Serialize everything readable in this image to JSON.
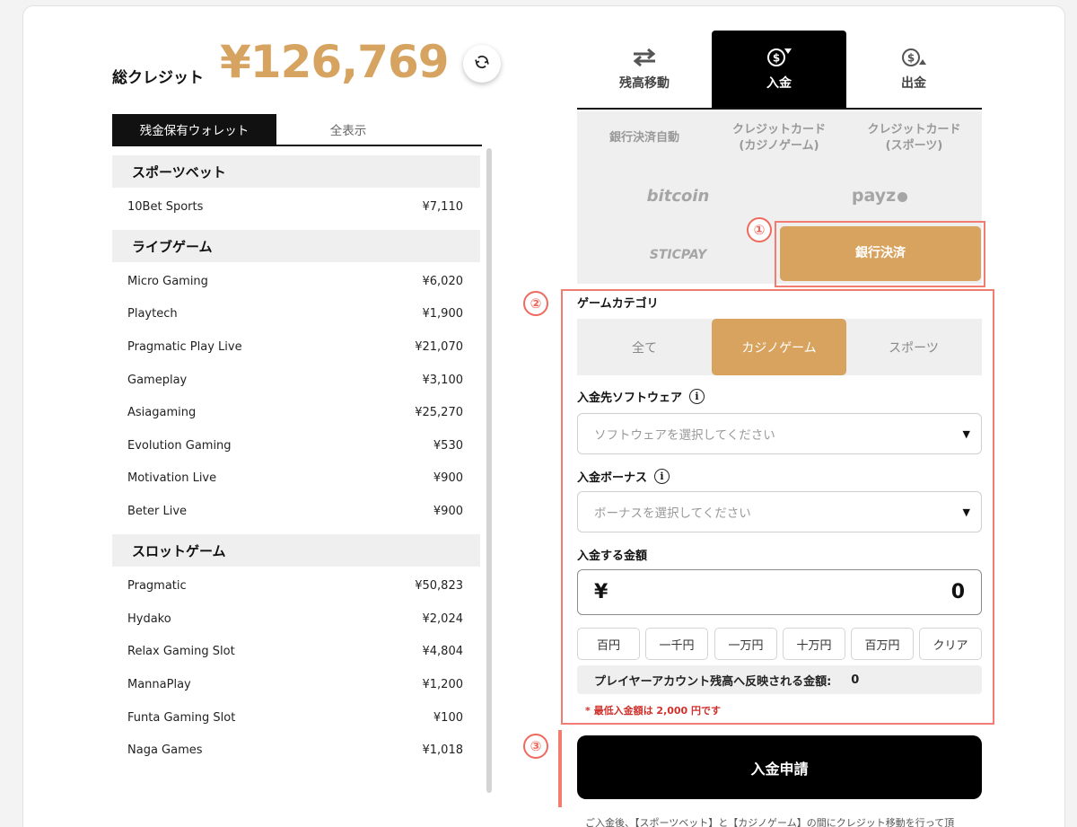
{
  "credit": {
    "label": "総クレジット",
    "amount": "¥126,769"
  },
  "wallet_tabs": {
    "active": "残金保有ウォレット",
    "inactive": "全表示"
  },
  "wallet": {
    "categories": [
      {
        "name": "スポーツベット",
        "rows": [
          {
            "name": "10Bet Sports",
            "value": "¥7,110"
          }
        ]
      },
      {
        "name": "ライブゲーム",
        "rows": [
          {
            "name": "Micro Gaming",
            "value": "¥6,020"
          },
          {
            "name": "Playtech",
            "value": "¥1,900"
          },
          {
            "name": "Pragmatic Play Live",
            "value": "¥21,070"
          },
          {
            "name": "Gameplay",
            "value": "¥3,100"
          },
          {
            "name": "Asiagaming",
            "value": "¥25,270"
          },
          {
            "name": "Evolution Gaming",
            "value": "¥530"
          },
          {
            "name": "Motivation Live",
            "value": "¥900"
          },
          {
            "name": "Beter Live",
            "value": "¥900"
          }
        ]
      },
      {
        "name": "スロットゲーム",
        "rows": [
          {
            "name": "Pragmatic",
            "value": "¥50,823"
          },
          {
            "name": "Hydako",
            "value": "¥2,024"
          },
          {
            "name": "Relax Gaming Slot",
            "value": "¥4,804"
          },
          {
            "name": "MannaPlay",
            "value": "¥1,200"
          },
          {
            "name": "Funta Gaming Slot",
            "value": "¥100"
          },
          {
            "name": "Naga Games",
            "value": "¥1,018"
          }
        ]
      }
    ]
  },
  "top_tabs": [
    {
      "label": "残高移動",
      "icon": "transfer-arrows-icon"
    },
    {
      "label": "入金",
      "icon": "dollar-down-icon",
      "active": true
    },
    {
      "label": "出金",
      "icon": "dollar-up-icon"
    }
  ],
  "methods": {
    "bank_auto": "銀行決済自動",
    "credit_casino_1": "クレジットカード",
    "credit_casino_2": "(カジノゲーム)",
    "credit_sports_1": "クレジットカード",
    "credit_sports_2": "(スポーツ)",
    "bitcoin": "bitcoin",
    "payz": "payz",
    "sticpay": "STICPAY",
    "bank_selected": "銀行決済"
  },
  "steps": [
    "①",
    "②",
    "③"
  ],
  "form": {
    "game_category_label": "ゲームカテゴリ",
    "segments": [
      "全て",
      "カジノゲーム",
      "スポーツ"
    ],
    "active_segment": "カジノゲーム",
    "software_label": "入金先ソフトウェア",
    "software_placeholder": "ソフトウェアを選択してください",
    "bonus_label": "入金ボーナス",
    "bonus_placeholder": "ボーナスを選択してください",
    "amount_label": "入金する金額",
    "currency": "¥",
    "amount_value": "0",
    "quick_buttons": [
      "百円",
      "一千円",
      "一万円",
      "十万円",
      "百万円",
      "クリア"
    ],
    "reflect_label": "プレイヤーアカウント残高へ反映される金額:",
    "reflect_value": "0",
    "min_note": "* 最低入金額は 2,000 円です",
    "submit_label": "入金申請",
    "footnote": "ご入金後、【スポーツベット】と【カジノゲーム】の間にクレジット移動を行って頂"
  },
  "colors": {
    "accent": "#d8a35e",
    "amount_gold": "#d6a460",
    "highlight_red": "#f07c72",
    "dark": "#000000"
  }
}
